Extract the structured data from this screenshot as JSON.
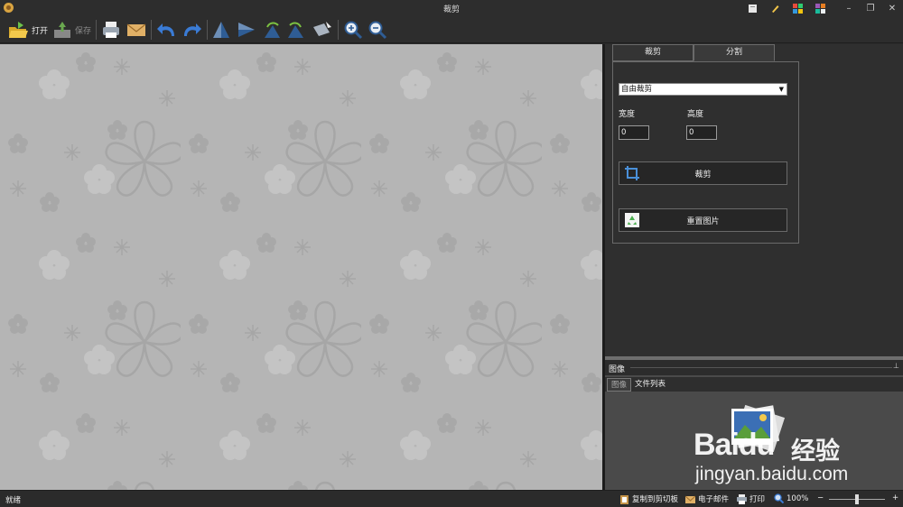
{
  "window": {
    "title": "裁剪"
  },
  "toolbar": {
    "open_label": "打开",
    "save_label": "保存",
    "icons": [
      "print-icon",
      "email-icon",
      "undo-icon",
      "redo-icon",
      "flip-vertical-icon",
      "flip-horizontal-icon",
      "rotate-left-icon",
      "rotate-right-icon",
      "rotate-free-icon",
      "zoom-in-icon",
      "zoom-out-icon"
    ]
  },
  "crop_panel": {
    "tabs": [
      "裁剪",
      "分割"
    ],
    "active_tab": 0,
    "mode_select": "自由裁剪",
    "width_label": "宽度",
    "width_value": "0",
    "height_label": "高度",
    "height_value": "0",
    "crop_button": "裁剪",
    "reset_button": "重置图片"
  },
  "image_pane": {
    "title": "图像",
    "tabs": [
      "图像",
      "文件列表"
    ]
  },
  "status": {
    "ready": "就绪",
    "copy": "复制到剪切板",
    "email": "电子邮件",
    "print": "打印",
    "zoom": "100%",
    "zoom_minus": "−",
    "zoom_plus": "+"
  },
  "watermark": {
    "brand": "Baidu",
    "brand_cn": "经验",
    "url": "jingyan.baidu.com"
  },
  "colors": {
    "background": "#2b2b2b",
    "canvas": "#b5b5b5",
    "accent_green": "#7cc242",
    "accent_blue": "#3a7bd5"
  }
}
